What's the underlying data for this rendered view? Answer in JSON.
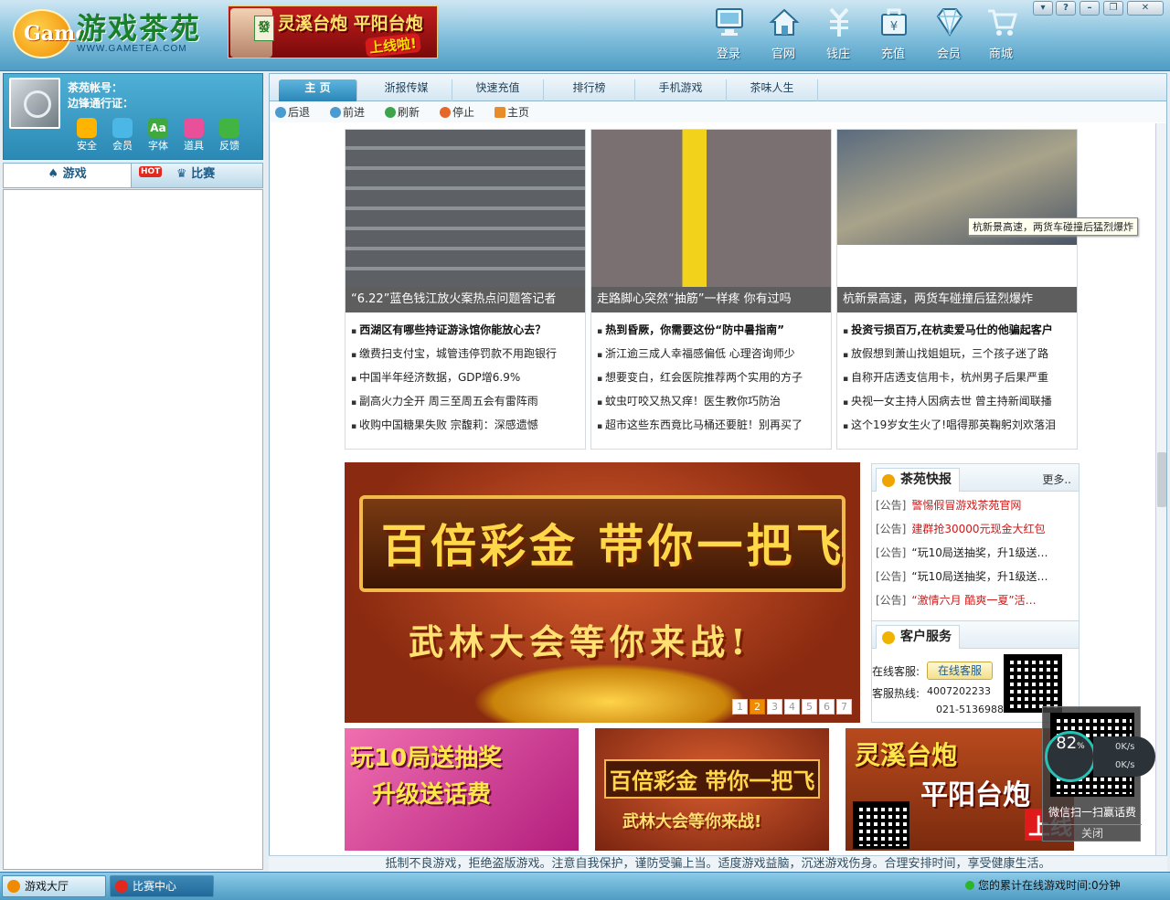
{
  "logo": {
    "sub": "WWW.GAMETEA.COM",
    "mark": "Game",
    "title": "游戏茶苑"
  },
  "top_ad": {
    "text1": "灵溪台炮 平阳台炮",
    "text2": "上线啦!",
    "tile": "發"
  },
  "top_nav": [
    {
      "label": "登录",
      "icon": "monitor-icon"
    },
    {
      "label": "官网",
      "icon": "home-icon"
    },
    {
      "label": "钱庄",
      "icon": "money-icon"
    },
    {
      "label": "充值",
      "icon": "recharge-icon"
    },
    {
      "label": "会员",
      "icon": "diamond-icon"
    },
    {
      "label": "商城",
      "icon": "cart-icon"
    }
  ],
  "window_controls": [
    "▾",
    "?",
    "–",
    "❐",
    "✕"
  ],
  "user": {
    "account_label": "茶苑帐号：",
    "pass_label": "边锋通行证："
  },
  "user_tools": [
    {
      "label": "安全",
      "color": "#ffb400"
    },
    {
      "label": "会员",
      "color": "#4bb7e6"
    },
    {
      "label": "字体",
      "color": "#3fa83f"
    },
    {
      "label": "道具",
      "color": "#e8509a"
    },
    {
      "label": "反馈",
      "color": "#42b442"
    }
  ],
  "left_tabs": {
    "games": "游戏",
    "hot": "HOT",
    "match": "比赛"
  },
  "browser_tabs": [
    "主 页",
    "浙报传媒",
    "快速充值",
    "排行榜",
    "手机游戏",
    "茶味人生"
  ],
  "browser_nav": [
    "后退",
    "前进",
    "刷新",
    "停止",
    "主页"
  ],
  "news_cards": [
    {
      "caption": "“6.22”蓝色钱江放火案热点问题答记者",
      "items": [
        "西湖区有哪些持证游泳馆你能放心去？",
        "缴费扫支付宝，城管违停罚款不用跑银行",
        "中国半年经济数据，GDP增6.9%",
        "副高火力全开 周三至周五会有雷阵雨",
        "收购中国糖果失败 宗馥莉：深感遗憾"
      ]
    },
    {
      "caption": "走路脚心突然“抽筋”一样疼 你有过吗",
      "items": [
        "热到昏厥，你需要这份“防中暑指南”",
        "浙江逾三成人幸福感偏低 心理咨询师少",
        "想要变白，红会医院推荐两个实用的方子",
        "蚊虫叮咬又热又痒！医生教你巧防治",
        "超市这些东西竟比马桶还要脏！别再买了"
      ]
    },
    {
      "caption": "杭新景高速，两货车碰撞后猛烈爆炸",
      "items": [
        "投资亏损百万,在杭卖爱马仕的他骗起客户",
        "放假想到萧山找姐姐玩，三个孩子迷了路",
        "自称开店透支信用卡，杭州男子后果严重",
        "央视一女主持人因病去世 曾主持新闻联播",
        "这个19岁女生火了!唱得那英鞠躬刘欢落泪"
      ]
    }
  ],
  "tooltip": "杭新景高速，两货车碰撞后猛烈爆炸",
  "banner": {
    "line1": "百倍彩金 带你一把飞",
    "line2": "武林大会等你来战!",
    "pages": [
      "1",
      "2",
      "3",
      "4",
      "5",
      "6",
      "7"
    ],
    "current_page": 2
  },
  "notice": {
    "title": "茶苑快报",
    "more": "更多..",
    "items": [
      {
        "tag": "[公告]",
        "text": "警惕假冒游戏茶苑官网",
        "color": "#d01818"
      },
      {
        "tag": "[公告]",
        "text": "建群抢30000元现金大红包",
        "color": "#d01818"
      },
      {
        "tag": "[公告]",
        "text": "“玩10局送抽奖，升1级送…",
        "color": "#222222"
      },
      {
        "tag": "[公告]",
        "text": "“玩10局送抽奖，升1级送…",
        "color": "#222222"
      },
      {
        "tag": "[公告]",
        "text": "“激情六月 酷爽一夏”活…",
        "color": "#d01818"
      }
    ]
  },
  "service": {
    "title": "客户服务",
    "online_label": "在线客服:",
    "online_btn": "在线客服",
    "hotline_label": "客服热线:",
    "phone1": "4007202233",
    "phone2": "021-51369888"
  },
  "promos": [
    {
      "line1": "玩10局送抽奖",
      "line2": "升级送话费"
    },
    {
      "line1": "百倍彩金 带你一把飞",
      "line2": "武林大会等你来战!"
    },
    {
      "line1": "灵溪台炮",
      "line2": "平阳台炮",
      "line3": "上线"
    }
  ],
  "widget": {
    "percent": "82",
    "unit": "%",
    "up": "0K/s",
    "down": "0K/s",
    "scan_text": "微信扫一扫赢话费",
    "close": "关闭"
  },
  "status_text": "抵制不良游戏，拒绝盗版游戏。注意自我保护，谨防受骗上当。适度游戏益脑，沉迷游戏伤身。合理安排时间，享受健康生活。",
  "taskbar": {
    "lobby": "游戏大厅",
    "match_center": "比赛中心",
    "online_time": "您的累计在线游戏时间:0分钟"
  }
}
